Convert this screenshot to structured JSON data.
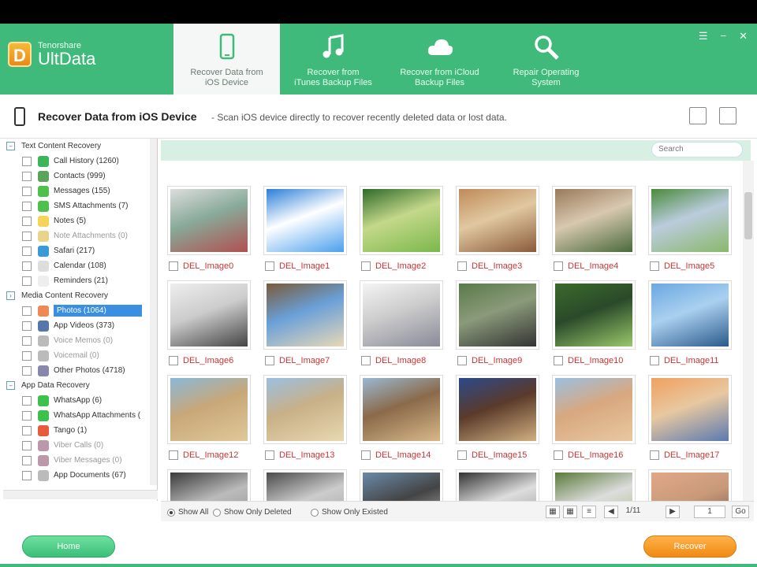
{
  "app": {
    "brand_small": "Tenorshare",
    "brand_big": "UltData",
    "logo_letter": "D"
  },
  "nav": [
    {
      "label_1": "Recover Data from",
      "label_2": "iOS Device",
      "icon": "phone-icon",
      "active": true
    },
    {
      "label_1": "Recover from",
      "label_2": "iTunes Backup Files",
      "icon": "music-note-icon"
    },
    {
      "label_1": "Recover from iCloud",
      "label_2": "Backup Files",
      "icon": "cloud-icon"
    },
    {
      "label_1": "Repair Operating",
      "label_2": "System",
      "icon": "wrench-search-icon"
    }
  ],
  "header": {
    "title": "Recover Data from iOS Device",
    "desc": "- Scan iOS device directly to recover recently deleted data or lost data."
  },
  "sidebar": {
    "sections": [
      {
        "label": "Text Content Recovery",
        "items": [
          {
            "label": "Call History (1260)",
            "color": "#3cb55a"
          },
          {
            "label": "Contacts (999)",
            "color": "#5aa55a"
          },
          {
            "label": "Messages (155)",
            "color": "#4cc24c"
          },
          {
            "label": "SMS Attachments (7)",
            "color": "#4cc24c"
          },
          {
            "label": "Notes (5)",
            "color": "#f5d45a"
          },
          {
            "label": "Note Attachments (0)",
            "color": "#e8d48a",
            "dim": true
          },
          {
            "label": "Safari (217)",
            "color": "#3a9ad8"
          },
          {
            "label": "Calendar (108)",
            "color": "#ddd"
          },
          {
            "label": "Reminders (21)",
            "color": "#eee"
          }
        ]
      },
      {
        "label": "Media Content Recovery",
        "items": [
          {
            "label": "Photos (1064)",
            "color": "#e85",
            "selected": true
          },
          {
            "label": "App Videos (373)",
            "color": "#5577aa"
          },
          {
            "label": "Voice Memos (0)",
            "color": "#bbb",
            "dim": true
          },
          {
            "label": "Voicemail (0)",
            "color": "#bbb",
            "dim": true
          },
          {
            "label": "Other Photos (4718)",
            "color": "#88a"
          }
        ]
      },
      {
        "label": "App Data Recovery",
        "items": [
          {
            "label": "WhatsApp (6)",
            "color": "#3cc24c"
          },
          {
            "label": "WhatsApp Attachments (",
            "color": "#3cc24c"
          },
          {
            "label": "Tango (1)",
            "color": "#e85a3a"
          },
          {
            "label": "Viber Calls (0)",
            "color": "#b9a",
            "dim": true
          },
          {
            "label": "Viber Messages (0)",
            "color": "#b9a",
            "dim": true
          },
          {
            "label": "App Documents (67)",
            "color": "#bbb"
          }
        ]
      }
    ]
  },
  "search": {
    "placeholder": "Search"
  },
  "thumbnails": [
    {
      "name": "DEL_Image0",
      "colors": [
        "#ddd",
        "#b05050",
        "#8a9"
      ]
    },
    {
      "name": "DEL_Image1",
      "colors": [
        "#2a7fd8",
        "#4aa0ee",
        "#fff"
      ]
    },
    {
      "name": "DEL_Image2",
      "colors": [
        "#2f6a2a",
        "#7ab84a",
        "#c4d88a"
      ]
    },
    {
      "name": "DEL_Image3",
      "colors": [
        "#c08a5a",
        "#8a5a3a",
        "#e0c8a0"
      ]
    },
    {
      "name": "DEL_Image4",
      "colors": [
        "#9a7a5a",
        "#4a6a3a",
        "#d8c8b0"
      ]
    },
    {
      "name": "DEL_Image5",
      "colors": [
        "#4a8a3a",
        "#8ab86a",
        "#bcd"
      ]
    },
    {
      "name": "DEL_Image6",
      "colors": [
        "#eee",
        "#444",
        "#ccc"
      ]
    },
    {
      "name": "DEL_Image7",
      "colors": [
        "#7a5a3a",
        "#e8d8b8",
        "#6aa0d8"
      ]
    },
    {
      "name": "DEL_Image8",
      "colors": [
        "#f4f4f4",
        "#8a8a9a",
        "#ccc"
      ]
    },
    {
      "name": "DEL_Image9",
      "colors": [
        "#5a7a4a",
        "#333",
        "#8a9a7a"
      ]
    },
    {
      "name": "DEL_Image10",
      "colors": [
        "#3a6a2a",
        "#9ac86a",
        "#2a4a2a"
      ]
    },
    {
      "name": "DEL_Image11",
      "colors": [
        "#6aa8e0",
        "#2a5a8a",
        "#aad0f0"
      ]
    },
    {
      "name": "DEL_Image12",
      "colors": [
        "#8ab8d8",
        "#e0c89a",
        "#c8a878"
      ]
    },
    {
      "name": "DEL_Image13",
      "colors": [
        "#9ac0e0",
        "#e8d8b0",
        "#c8b088"
      ]
    },
    {
      "name": "DEL_Image14",
      "colors": [
        "#9ab8d0",
        "#d8b888",
        "#8a6a4a"
      ]
    },
    {
      "name": "DEL_Image15",
      "colors": [
        "#2a4a8a",
        "#d0b080",
        "#5a3a2a"
      ]
    },
    {
      "name": "DEL_Image16",
      "colors": [
        "#9ac0e0",
        "#e8c8a0",
        "#d8a880"
      ]
    },
    {
      "name": "DEL_Image17",
      "colors": [
        "#f0a060",
        "#5a7ab0",
        "#e8c8a0"
      ]
    },
    {
      "name": "",
      "colors": [
        "#3a3a3a",
        "#888",
        "#bbb"
      ]
    },
    {
      "name": "",
      "colors": [
        "#4a4a4a",
        "#999",
        "#ccc"
      ]
    },
    {
      "name": "",
      "colors": [
        "#6a8aa8",
        "#ccc",
        "#444"
      ]
    },
    {
      "name": "",
      "colors": [
        "#333",
        "#8a8a8a",
        "#ddd"
      ]
    },
    {
      "name": "",
      "colors": [
        "#5a7a3a",
        "#9ab86a",
        "#ddd"
      ]
    },
    {
      "name": "",
      "colors": [
        "#e0a888",
        "#6a4a3a",
        "#c89a7a"
      ]
    }
  ],
  "footer": {
    "show_all": "Show All",
    "show_deleted": "Show Only Deleted",
    "show_existed": "Show Only Existed",
    "page": "1/11",
    "goto": "Go",
    "page_input": "1"
  },
  "buttons": {
    "home": "Home",
    "recover": "Recover"
  }
}
